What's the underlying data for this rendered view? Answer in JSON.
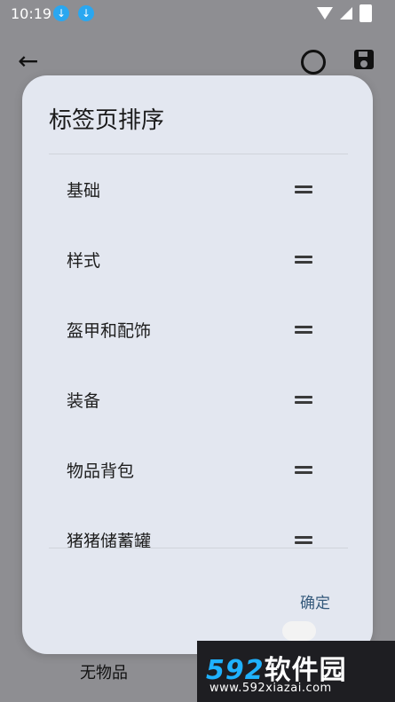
{
  "status_bar": {
    "time": "10:19"
  },
  "dialog": {
    "title": "标签页排序",
    "items": [
      {
        "label": "基础"
      },
      {
        "label": "样式"
      },
      {
        "label": "盔甲和配饰"
      },
      {
        "label": "装备"
      },
      {
        "label": "物品背包"
      },
      {
        "label": "猪猪储蓄罐"
      }
    ],
    "confirm_label": "确定"
  },
  "background": {
    "bottom_item": "无物品"
  },
  "watermark": {
    "logo_num": "592",
    "logo_cn": "软件园",
    "url": "www.592xiazai.com"
  },
  "colors": {
    "dialog_bg": "#e3e7f0",
    "accent": "#355a7c",
    "scrim": "#8e8e92"
  }
}
